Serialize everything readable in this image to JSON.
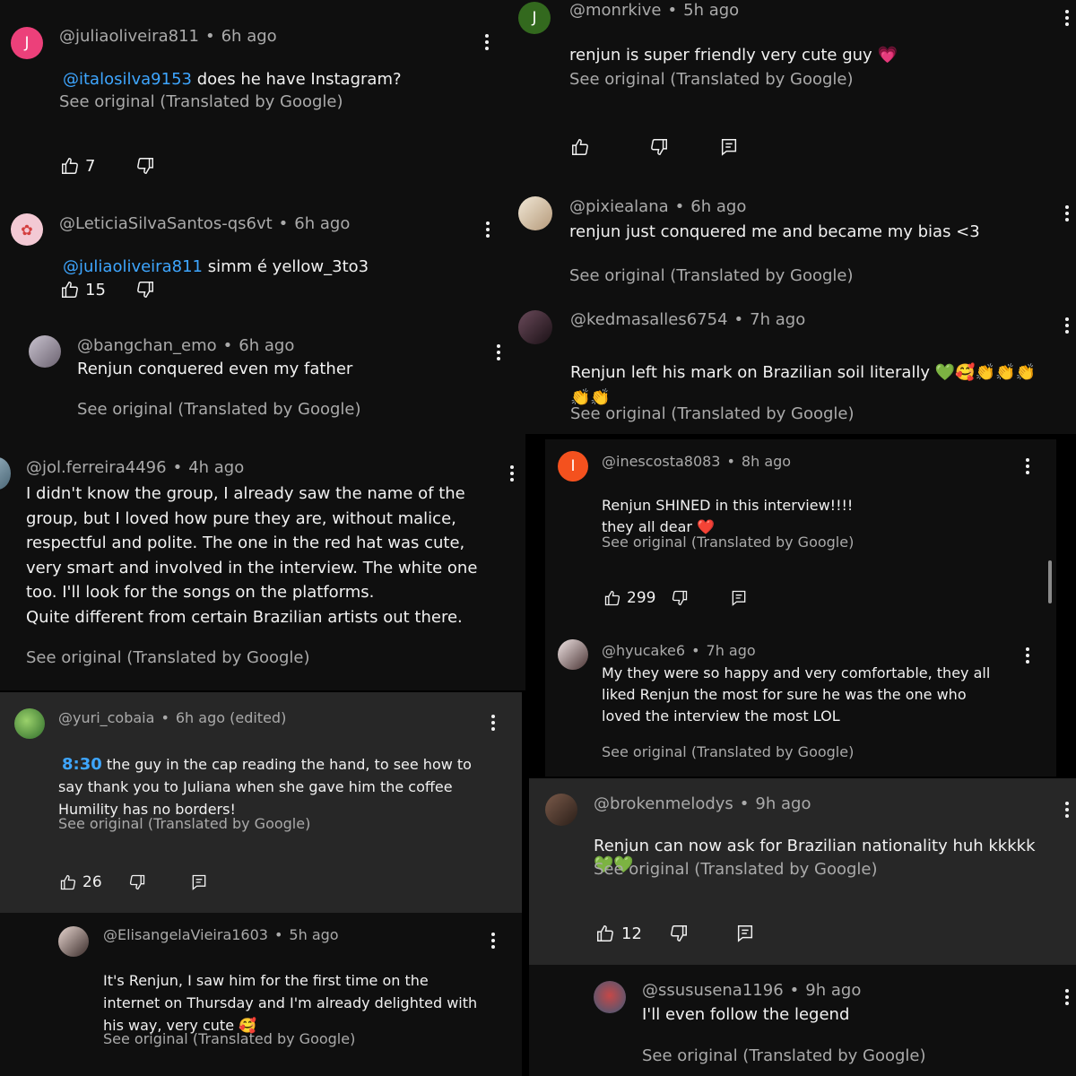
{
  "left": {
    "c1": {
      "avatar_letter": "J",
      "author": "@juliaoliveira811",
      "time": "6h ago",
      "mention": "@italosilva9153",
      "text": " does he have Instagram?",
      "see_original": "See original (Translated by Google)",
      "likes": "7"
    },
    "c2": {
      "author": "@LeticiaSilvaSantos-qs6vt",
      "time": "6h ago",
      "mention": "@juliaoliveira811",
      "text": " simm é yellow_3to3",
      "likes": "15"
    },
    "c3": {
      "author": "@bangchan_emo",
      "time": "6h ago",
      "text": "Renjun conquered even my father",
      "see_original": "See original (Translated by Google)"
    },
    "c4": {
      "author": "@jol.ferreira4496",
      "time": "4h ago",
      "text": "I didn't know the group, I already saw the name of the group, but I loved how pure they are, without malice, respectful and polite. The one in the red hat was cute, very smart and involved in the interview. The white one too. I'll look for the songs on the platforms.\nQuite different from certain Brazilian artists out there.",
      "see_original": "See original (Translated by Google)"
    },
    "c5": {
      "author": "@yuri_cobaia",
      "time": "6h ago (edited)",
      "timestamp": "8:30",
      "text": " the guy in the cap reading the hand, to see how to say thank you to Juliana when she gave him the coffee\nHumility has no borders!",
      "see_original": "See original (Translated by Google)",
      "likes": "26"
    },
    "c6": {
      "author": "@ElisangelaVieira1603",
      "time": "5h ago",
      "text": "It's Renjun, I saw him for the first time on the internet on Thursday and I'm already delighted with his way, very cute",
      "emoji": "🥰",
      "see_original": "See original (Translated by Google)"
    }
  },
  "right": {
    "r1": {
      "avatar_letter": "J",
      "author": "@monrkive",
      "time": "5h ago",
      "text": "renjun is super friendly very cute guy ",
      "emoji": "💗",
      "see_original": "See original (Translated by Google)"
    },
    "r2": {
      "author": "@pixiealana",
      "time": "6h ago",
      "text": "renjun just conquered me and became my bias <3",
      "see_original": "See original (Translated by Google)"
    },
    "r3": {
      "author": "@kedmasalles6754",
      "time": "7h ago",
      "text": "Renjun left his mark on Brazilian soil literally ",
      "emoji_heart": "💚",
      "emoji_rest": "🥰👏👏👏\n👏👏",
      "see_original": "See original (Translated by Google)"
    },
    "r4": {
      "avatar_letter": "I",
      "author": "@inescosta8083",
      "time": "8h ago",
      "text": "Renjun SHINED in this interview!!!!\nthey all dear ",
      "emoji": "❤️",
      "see_original": "See original (Translated by Google)",
      "likes": "299"
    },
    "r5": {
      "author": "@hyucake6",
      "time": "7h ago",
      "text": "My they were so happy and very comfortable, they all liked Renjun the most for sure he was the one who loved the interview the most LOL",
      "see_original": "See original (Translated by Google)"
    },
    "r6": {
      "author": "@brokenmelodys",
      "time": "9h ago",
      "text": "Renjun can now ask for Brazilian nationality huh kkkkk ",
      "emoji": "💚💚",
      "see_original": "See original (Translated by Google)",
      "likes": "12"
    },
    "r7": {
      "author": "@ssususena1196",
      "time": "9h ago",
      "text": "I'll even follow the legend",
      "see_original": "See original (Translated by Google)"
    }
  },
  "colors": {
    "bg": "#000000",
    "panel_dark": "#0f0f0f",
    "panel_highlight": "#272727",
    "text": "#f1f1f1",
    "meta": "#aaaaaa",
    "link": "#3ea6ff"
  }
}
